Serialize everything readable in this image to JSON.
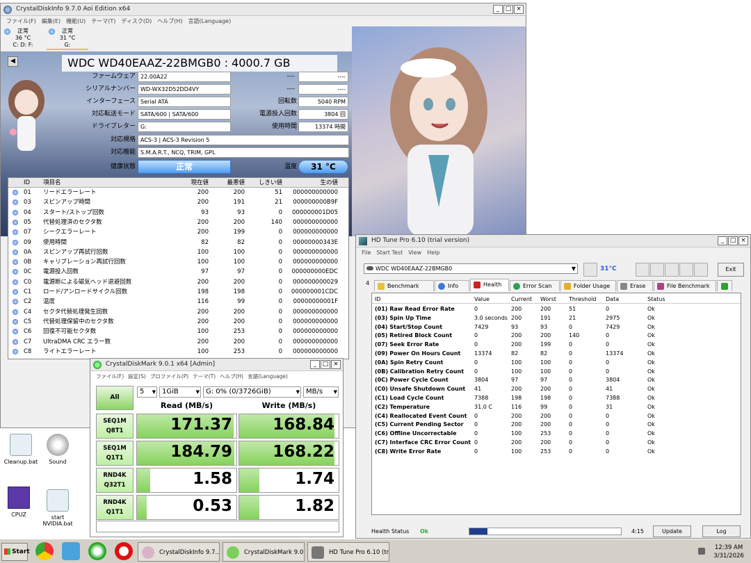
{
  "cdi": {
    "title": "CrystalDiskInfo 9.7.0 Aoi Edition x64",
    "menu": [
      "ファイル(F)",
      "編集(E)",
      "機能(U)",
      "テーマ(T)",
      "ディスク(D)",
      "ヘルプ(H)",
      "言語(Language)"
    ],
    "drives": [
      {
        "status": "正常",
        "temp": "36 °C",
        "letter": "C: D: F:"
      },
      {
        "status": "正常",
        "temp": "31 °C",
        "letter": "G:"
      }
    ],
    "model": "WDC WD40EAAZ-22BMGB0 : 4000.7 GB",
    "labels": {
      "firmware": "ファームウェア",
      "serial": "シリアルナンバー",
      "interface": "インターフェース",
      "transfer": "対応転送モード",
      "letter": "ドライブレター",
      "standard": "対応規格",
      "features": "対応機能",
      "health": "健康状態",
      "rotation": "回転数",
      "powercount": "電源投入回数",
      "powerhours": "使用時間",
      "temp": "温度"
    },
    "values": {
      "firmware": "22.00A22",
      "serial": "WD-WX32D52DD4VY",
      "interface": "Serial ATA",
      "transfer": "SATA/600 | SATA/600",
      "letter": "G:",
      "standard": "ACS-3 | ACS-3 Revision 5",
      "features": "S.M.A.R.T., NCQ, TRIM, GPL",
      "health": "正常",
      "rotation": "5040 RPM",
      "powercount": "3804 回",
      "powerhours": "13374 時間",
      "temp": "31 °C",
      "blank1": "----",
      "blank2": "----",
      "blank3": "----",
      "blank4": "----"
    },
    "headers": [
      "ID",
      "項目名",
      "現在値",
      "最悪値",
      "しきい値",
      "生の値"
    ],
    "rows": [
      [
        "01",
        "リードエラーレート",
        "200",
        "200",
        "51",
        "000000000000"
      ],
      [
        "03",
        "スピンアップ時間",
        "200",
        "191",
        "21",
        "000000000B9F"
      ],
      [
        "04",
        "スタート/ストップ回数",
        "93",
        "93",
        "0",
        "000000001D05"
      ],
      [
        "05",
        "代替処理済のセクタ数",
        "200",
        "200",
        "140",
        "000000000000"
      ],
      [
        "07",
        "シークエラーレート",
        "200",
        "199",
        "0",
        "000000000000"
      ],
      [
        "09",
        "使用時間",
        "82",
        "82",
        "0",
        "00000000343E"
      ],
      [
        "0A",
        "スピンアップ再試行回数",
        "100",
        "100",
        "0",
        "000000000000"
      ],
      [
        "0B",
        "キャリブレーション再試行回数",
        "100",
        "100",
        "0",
        "000000000000"
      ],
      [
        "0C",
        "電源投入回数",
        "97",
        "97",
        "0",
        "000000000EDC"
      ],
      [
        "C0",
        "電源断による磁気ヘッド退避回数",
        "200",
        "200",
        "0",
        "000000000029"
      ],
      [
        "C1",
        "ロード/アンロードサイクル回数",
        "198",
        "198",
        "0",
        "000000001CDC"
      ],
      [
        "C2",
        "温度",
        "116",
        "99",
        "0",
        "00000000001F"
      ],
      [
        "C4",
        "セクタ代替処理発生回数",
        "200",
        "200",
        "0",
        "000000000000"
      ],
      [
        "C5",
        "代替処理保留中のセクタ数",
        "200",
        "200",
        "0",
        "000000000000"
      ],
      [
        "C6",
        "回復不可能セクタ数",
        "100",
        "253",
        "0",
        "000000000000"
      ],
      [
        "C7",
        "UltraDMA CRC エラー数",
        "200",
        "200",
        "0",
        "000000000000"
      ],
      [
        "C8",
        "ライトエラーレート",
        "100",
        "253",
        "0",
        "000000000000"
      ]
    ]
  },
  "cdm": {
    "title": "CrystalDiskMark 9.0.1 x64 [Admin]",
    "menu": [
      "ファイル(F)",
      "設定(S)",
      "プロファイル(P)",
      "テーマ(T)",
      "ヘルプ(H)",
      "言語(Language)"
    ],
    "all": "All",
    "count": "5",
    "size": "1GiB",
    "drive": "G: 0% (0/3726GiB)",
    "unit": "MB/s",
    "read_header": "Read (MB/s)",
    "write_header": "Write (MB/s)",
    "tests": [
      {
        "l1": "SEQ1M",
        "l2": "Q8T1",
        "read": "171.37",
        "write": "168.84",
        "rfill": 0.97,
        "wfill": 0.96
      },
      {
        "l1": "SEQ1M",
        "l2": "Q1T1",
        "read": "184.79",
        "write": "168.22",
        "rfill": 0.98,
        "wfill": 0.96
      },
      {
        "l1": "RND4K",
        "l2": "Q32T1",
        "read": "1.58",
        "write": "1.74",
        "rfill": 0.13,
        "wfill": 0.2
      },
      {
        "l1": "RND4K",
        "l2": "Q1T1",
        "read": "0.53",
        "write": "1.82",
        "rfill": 0.1,
        "wfill": 0.2
      }
    ]
  },
  "hdt": {
    "title": "HD Tune Pro 6.10 (trial version)",
    "menu": [
      "File",
      "Start Test",
      "View",
      "Help"
    ],
    "drive": "WDC WD40EAAZ-22BMGB0",
    "temp": "31°C",
    "exit": "Exit",
    "tabs": [
      "Benchmark",
      "Info",
      "Health",
      "Error Scan",
      "Folder Usage",
      "Erase",
      "File Benchmark"
    ],
    "headers": [
      "ID",
      "Value",
      "Current",
      "Worst",
      "Threshold",
      "Data",
      "Status"
    ],
    "rows": [
      [
        "(01) Raw Read Error Rate",
        "0",
        "200",
        "200",
        "51",
        "0",
        "Ok"
      ],
      [
        "(03) Spin Up Time",
        "3.0 seconds",
        "200",
        "191",
        "21",
        "2975",
        "Ok"
      ],
      [
        "(04) Start/Stop Count",
        "7429",
        "93",
        "93",
        "0",
        "7429",
        "Ok"
      ],
      [
        "(05) Retired Block Count",
        "0",
        "200",
        "200",
        "140",
        "0",
        "Ok"
      ],
      [
        "(07) Seek Error Rate",
        "0",
        "200",
        "199",
        "0",
        "0",
        "Ok"
      ],
      [
        "(09) Power On Hours Count",
        "13374",
        "82",
        "82",
        "0",
        "13374",
        "Ok"
      ],
      [
        "(0A) Spin Retry Count",
        "0",
        "100",
        "100",
        "0",
        "0",
        "Ok"
      ],
      [
        "(0B) Calibration Retry Count",
        "0",
        "100",
        "100",
        "0",
        "0",
        "Ok"
      ],
      [
        "(0C) Power Cycle Count",
        "3804",
        "97",
        "97",
        "0",
        "3804",
        "Ok"
      ],
      [
        "(C0) Unsafe Shutdown Count",
        "41",
        "200",
        "200",
        "0",
        "41",
        "Ok"
      ],
      [
        "(C1) Load Cycle Count",
        "7388",
        "198",
        "198",
        "0",
        "7388",
        "Ok"
      ],
      [
        "(C2) Temperature",
        "31.0 C",
        "116",
        "99",
        "0",
        "31",
        "Ok"
      ],
      [
        "(C4) Reallocated Event Count",
        "0",
        "200",
        "200",
        "0",
        "0",
        "Ok"
      ],
      [
        "(C5) Current Pending Sector",
        "0",
        "200",
        "200",
        "0",
        "0",
        "Ok"
      ],
      [
        "(C6) Offline Uncorrectable",
        "0",
        "100",
        "253",
        "0",
        "0",
        "Ok"
      ],
      [
        "(C7) Interface CRC Error Count",
        "0",
        "200",
        "200",
        "0",
        "0",
        "Ok"
      ],
      [
        "(C8) Write Error Rate",
        "0",
        "100",
        "253",
        "0",
        "0",
        "Ok"
      ]
    ],
    "health_label": "Health Status",
    "health_value": "Ok",
    "health_progress": 0.12,
    "time": "4:15",
    "update": "Update",
    "log": "Log"
  },
  "desktop": {
    "icons": [
      {
        "label": "Cleanup.bat"
      },
      {
        "label": "Sound"
      },
      {
        "label": "CPUZ"
      },
      {
        "label": "start NVIDIA.bat"
      }
    ]
  },
  "taskbar": {
    "start": "Start",
    "tasks": [
      "CrystalDiskInfo 9.7....",
      "CrystalDiskMark 9.0....",
      "HD Tune Pro 6.10 (tri..."
    ],
    "time": "12:39 AM",
    "date": "3/31/2026"
  },
  "colors": {
    "accent_blue": "#2a5ad8",
    "cdm_green": "#7ad04a",
    "health_ok": "#2bb02b",
    "hdt_progress": "#1f3f8c"
  }
}
